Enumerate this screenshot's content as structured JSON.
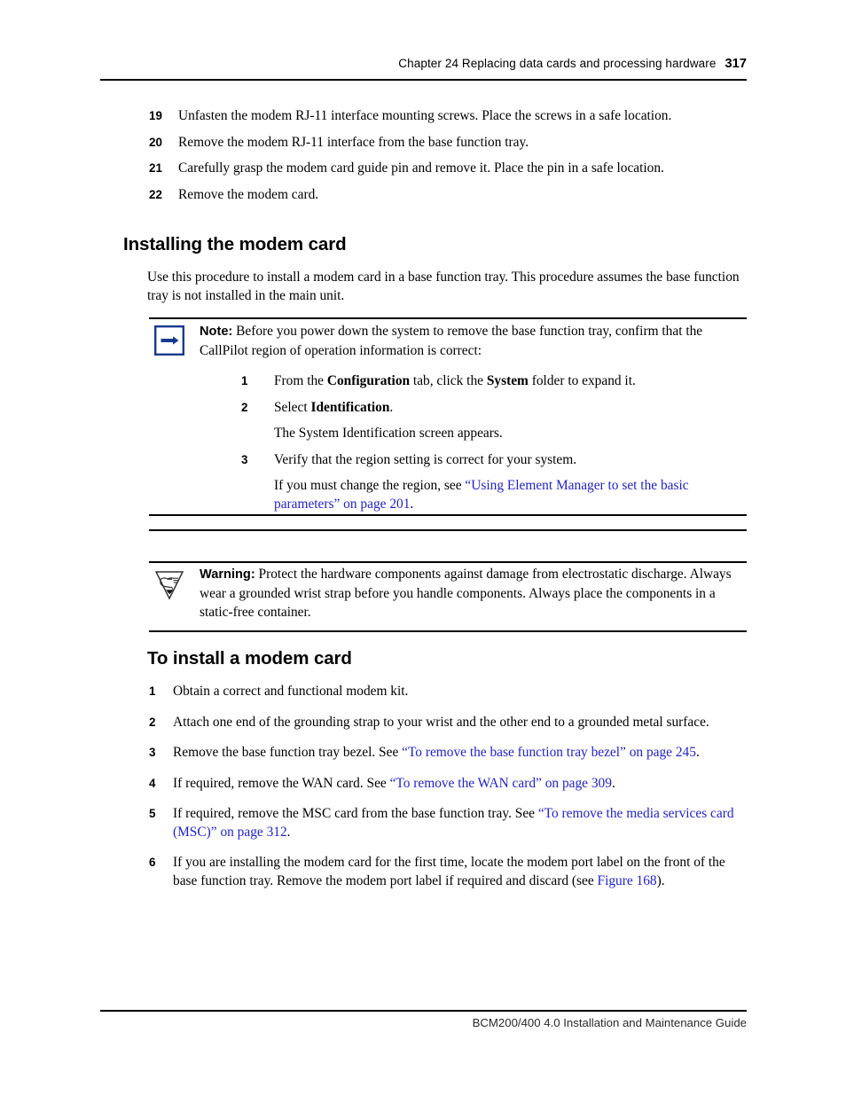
{
  "header": {
    "chapter": "Chapter 24  Replacing data cards and processing hardware",
    "page_number": "317"
  },
  "footer": {
    "guide_title": "BCM200/400 4.0 Installation and Maintenance Guide"
  },
  "colors": {
    "xref_link": "#2222CC",
    "note_icon_blue": "#1A3A8F",
    "text": "#000000"
  },
  "top_steps": [
    {
      "num": "19",
      "text": "Unfasten the modem RJ-11 interface mounting screws. Place the screws in a safe location."
    },
    {
      "num": "20",
      "text": "Remove the modem RJ-11 interface from the base function tray."
    },
    {
      "num": "21",
      "text": "Carefully grasp the modem card guide pin and remove it. Place the pin in a safe location."
    },
    {
      "num": "22",
      "text": "Remove the modem card."
    }
  ],
  "section_installing": {
    "heading": "Installing the modem card",
    "intro": "Use this procedure to install a modem card in a base function tray. This procedure assumes the base function tray is not installed in the main unit."
  },
  "note": {
    "icon": "note-arrow-icon",
    "label": "Note:",
    "text": " Before you power down the system to remove the base function tray, confirm that the CallPilot region of operation information is correct:",
    "substeps": [
      {
        "num": "1",
        "pre": "From the ",
        "bold1": "Configuration",
        "mid": " tab, click the ",
        "bold2": "System",
        "post": " folder to expand it."
      },
      {
        "num": "2",
        "pre": "Select ",
        "bold1": "Identification",
        "mid": "",
        "bold2": "",
        "post": "."
      }
    ],
    "result_text": "The System Identification screen appears.",
    "step3": {
      "num": "3",
      "text": "Verify that the region setting is correct for your system."
    },
    "region_note": {
      "pre": "If you must change the region, see ",
      "link": "“Using Element Manager to set the basic parameters” on page 201",
      "post": "."
    }
  },
  "warning": {
    "icon": "esd-warning-icon",
    "label": "Warning:",
    "text": " Protect the hardware components against damage from electrostatic discharge. Always wear a grounded wrist strap before you handle components. Always place the components in a static-free container."
  },
  "section_toinstall": {
    "heading": "To install a modem card"
  },
  "bottom_steps": [
    {
      "num": "1",
      "pre": "Obtain a correct and functional modem kit.",
      "link": "",
      "post": ""
    },
    {
      "num": "2",
      "pre": "Attach one end of the grounding strap to your wrist and the other end to a grounded metal surface.",
      "link": "",
      "post": ""
    },
    {
      "num": "3",
      "pre": "Remove the base function tray bezel. See ",
      "link": "“To remove the base function tray bezel” on page 245",
      "post": "."
    },
    {
      "num": "4",
      "pre": "If required, remove the WAN card. See ",
      "link": "“To remove the WAN card” on page 309",
      "post": "."
    },
    {
      "num": "5",
      "pre": "If required, remove the MSC card from the base function tray. See ",
      "link": "“To remove the media services card (MSC)” on page 312",
      "post": "."
    },
    {
      "num": "6",
      "pre": "If you are installing the modem card for the first time, locate the modem port label on the front of the base function tray. Remove the modem port label if required and discard (see ",
      "link": "Figure 168",
      "post": ")."
    }
  ]
}
